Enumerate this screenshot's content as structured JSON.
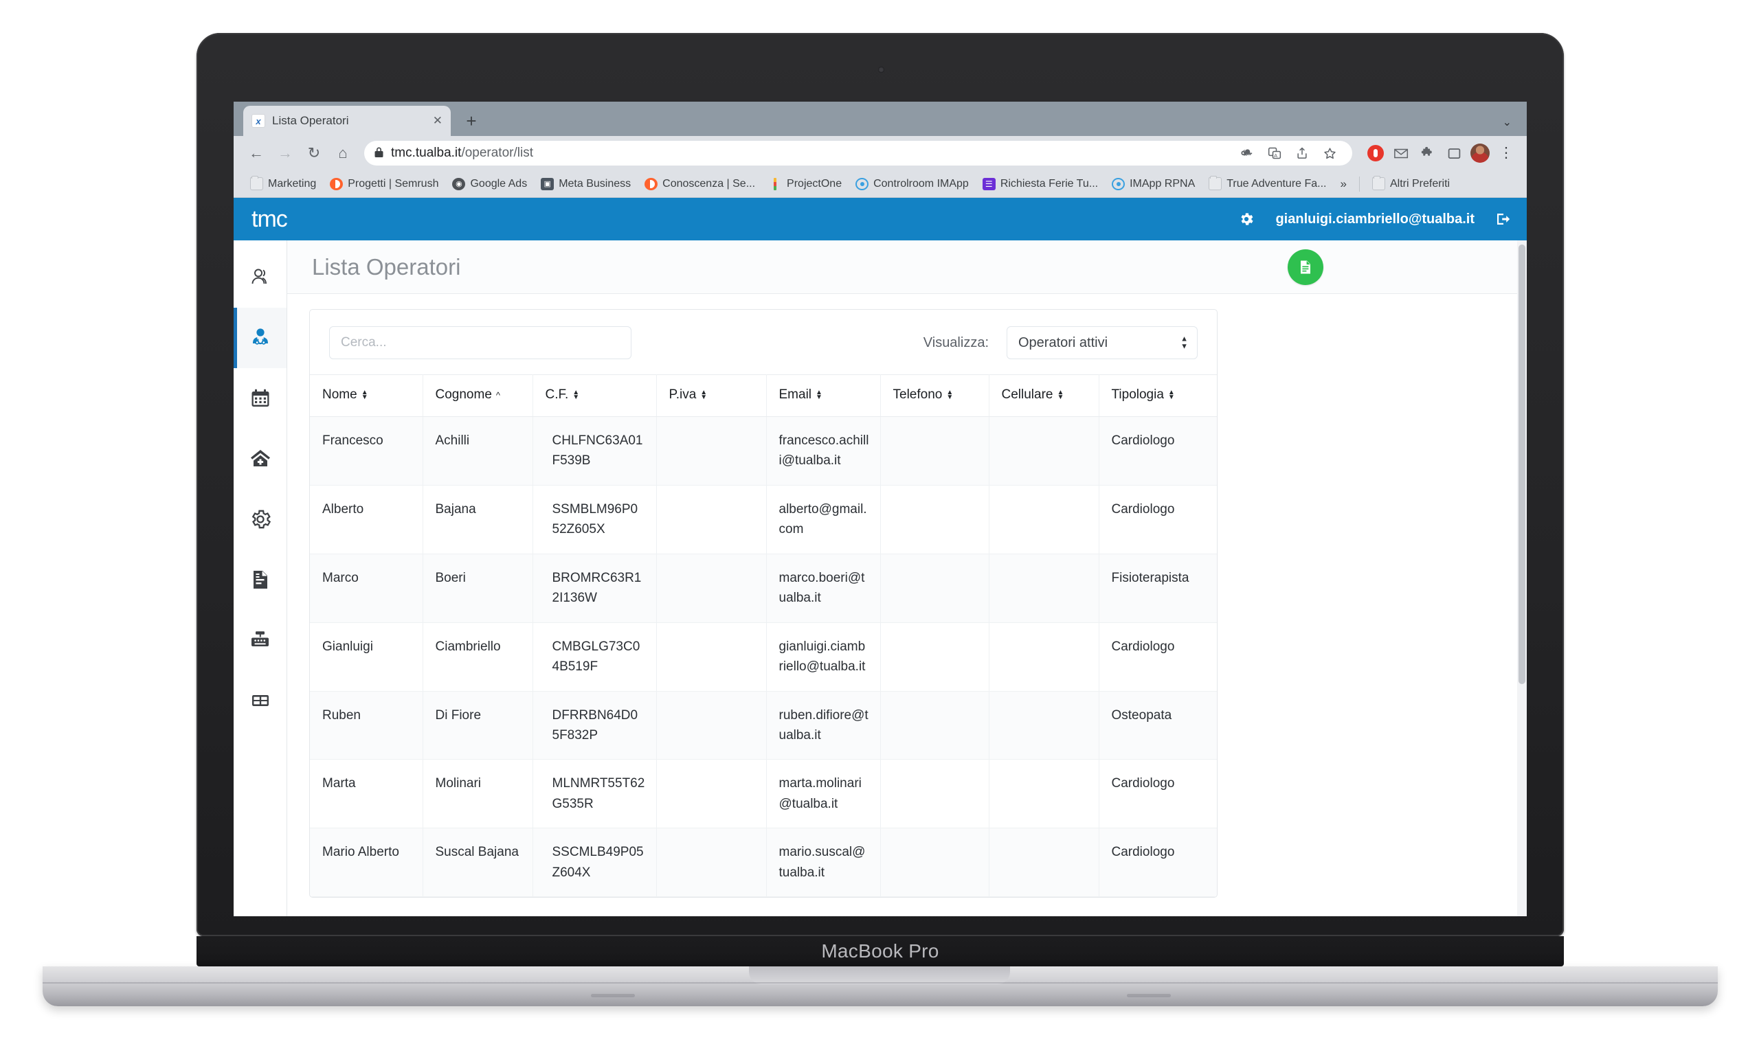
{
  "device": {
    "label": "MacBook Pro"
  },
  "browser": {
    "tab": {
      "title": "Lista Operatori",
      "favicon": "tualba-icon",
      "close_label": "✕"
    },
    "new_tab_label": "+",
    "tabstrip_chevron": "⌄",
    "nav": {
      "back": "←",
      "forward": "→",
      "reload": "↻",
      "home": "⌂"
    },
    "omnibox": {
      "lock": "🔒",
      "host": "tmc.tualba.it",
      "path": "/operator/list"
    },
    "omni_actions": [
      "key-icon",
      "translate-icon",
      "share-icon",
      "star-icon"
    ],
    "extensions": [
      "opera-icon",
      "mail-icon",
      "puzzle-icon",
      "sidepanel-icon",
      "profile-avatar",
      "kebab-menu"
    ],
    "bookmarks": [
      {
        "label": "Marketing",
        "icon": "folder-icon"
      },
      {
        "label": "Progetti | Semrush",
        "icon": "semrush-icon"
      },
      {
        "label": "Google Ads",
        "icon": "globe-icon"
      },
      {
        "label": "Meta Business",
        "icon": "meta-icon"
      },
      {
        "label": "Conoscenza | Se...",
        "icon": "semrush-icon"
      },
      {
        "label": "ProjectOne",
        "icon": "projectone-icon"
      },
      {
        "label": "Controlroom IMApp",
        "icon": "ring-icon"
      },
      {
        "label": "Richiesta Ferie Tu...",
        "icon": "sheets-icon"
      },
      {
        "label": "IMApp RPNA",
        "icon": "ring-icon"
      },
      {
        "label": "True Adventure Fa...",
        "icon": "folder-icon"
      }
    ],
    "bookmarks_overflow": "»",
    "other_bookmarks": {
      "label": "Altri Preferiti",
      "icon": "folder-icon"
    }
  },
  "app": {
    "brand": "tmc",
    "user_email": "gianluigi.ciambriello@tualba.it",
    "gear_icon": "gear-icon",
    "logout_icon": "logout-icon",
    "accent_color": "#1382c4",
    "fab_color": "#2fc04f",
    "page_title": "Lista Operatori",
    "export_button_icon": "document-export-icon",
    "sidebar": [
      {
        "name": "users",
        "icon": "users-icon",
        "active": false
      },
      {
        "name": "operators",
        "icon": "doctor-icon",
        "active": true
      },
      {
        "name": "calendar",
        "icon": "calendar-icon",
        "active": false
      },
      {
        "name": "clinic",
        "icon": "clinic-home-icon",
        "active": false
      },
      {
        "name": "settings",
        "icon": "gear-icon",
        "active": false
      },
      {
        "name": "documents",
        "icon": "document-icon",
        "active": false
      },
      {
        "name": "cash-register",
        "icon": "cash-register-icon",
        "active": false
      },
      {
        "name": "tables",
        "icon": "table-grid-icon",
        "active": false
      }
    ],
    "filters": {
      "search_placeholder": "Cerca...",
      "search_value": "",
      "visualizza_label": "Visualizza:",
      "select_value": "Operatori attivi",
      "select_options": [
        "Operatori attivi"
      ]
    },
    "table": {
      "columns": [
        {
          "label": "Nome",
          "sort": "none"
        },
        {
          "label": "Cognome",
          "sort": "asc"
        },
        {
          "label": "C.F.",
          "sort": "none"
        },
        {
          "label": "P.iva",
          "sort": "none"
        },
        {
          "label": "Email",
          "sort": "none"
        },
        {
          "label": "Telefono",
          "sort": "none"
        },
        {
          "label": "Cellulare",
          "sort": "none"
        },
        {
          "label": "Tipologia",
          "sort": "none"
        }
      ],
      "rows": [
        {
          "nome": "Francesco",
          "cognome": "Achilli",
          "cf": "CHLFNC63A01F539B",
          "piva": "",
          "email": "francesco.achilli@tualba.it",
          "telefono": "",
          "cellulare": "",
          "tipologia": "Cardiologo"
        },
        {
          "nome": "Alberto",
          "cognome": "Bajana",
          "cf": "SSMBLM96P052Z605X",
          "piva": "",
          "email": "alberto@gmail.com",
          "telefono": "",
          "cellulare": "",
          "tipologia": "Cardiologo"
        },
        {
          "nome": "Marco",
          "cognome": "Boeri",
          "cf": "BROMRC63R12I136W",
          "piva": "",
          "email": "marco.boeri@tualba.it",
          "telefono": "",
          "cellulare": "",
          "tipologia": "Fisioterapista"
        },
        {
          "nome": "Gianluigi",
          "cognome": "Ciambriello",
          "cf": "CMBGLG73C04B519F",
          "piva": "",
          "email": "gianluigi.ciambriello@tualba.it",
          "telefono": "",
          "cellulare": "",
          "tipologia": "Cardiologo"
        },
        {
          "nome": "Ruben",
          "cognome": "Di Fiore",
          "cf": "DFRRBN64D05F832P",
          "piva": "",
          "email": "ruben.difiore@tualba.it",
          "telefono": "",
          "cellulare": "",
          "tipologia": "Osteopata"
        },
        {
          "nome": "Marta",
          "cognome": "Molinari",
          "cf": "MLNMRT55T62G535R",
          "piva": "",
          "email": "marta.molinari@tualba.it",
          "telefono": "",
          "cellulare": "",
          "tipologia": "Cardiologo"
        },
        {
          "nome": "Mario Alberto",
          "cognome": "Suscal Bajana",
          "cf": "SSCMLB49P05Z604X",
          "piva": "",
          "email": "mario.suscal@tualba.it",
          "telefono": "",
          "cellulare": "",
          "tipologia": "Cardiologo"
        }
      ]
    }
  }
}
